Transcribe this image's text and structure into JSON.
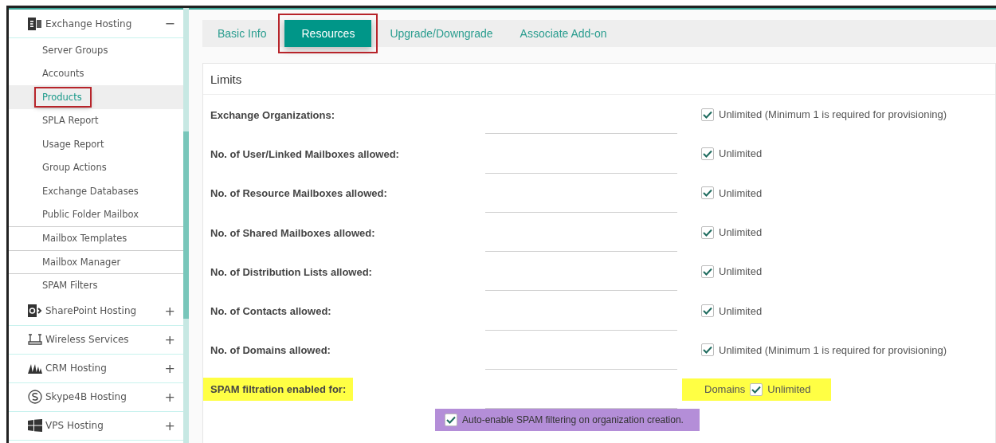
{
  "sidebar": {
    "items": [
      {
        "label": "Exchange Hosting",
        "expanded": true,
        "toggle": "−",
        "children": [
          {
            "label": "Server Groups",
            "selected": false,
            "outlined": false
          },
          {
            "label": "Accounts",
            "selected": false,
            "outlined": false
          },
          {
            "label": "Products",
            "selected": true,
            "outlined": true
          },
          {
            "label": "SPLA Report",
            "selected": false,
            "outlined": false
          },
          {
            "label": "Usage Report",
            "selected": false,
            "outlined": false
          },
          {
            "label": "Group Actions",
            "selected": false,
            "outlined": false
          },
          {
            "label": "Exchange Databases",
            "selected": false,
            "outlined": false
          },
          {
            "label": "Public Folder Mailbox",
            "selected": false,
            "outlined": false
          },
          {
            "label": "Mailbox Templates",
            "selected": false,
            "outlined": false
          },
          {
            "label": "Mailbox Manager",
            "selected": false,
            "outlined": false
          },
          {
            "label": "SPAM Filters",
            "selected": false,
            "outlined": false
          }
        ]
      },
      {
        "label": "SharePoint Hosting",
        "expanded": false,
        "toggle": "+"
      },
      {
        "label": "Wireless Services",
        "expanded": false,
        "toggle": "+"
      },
      {
        "label": "CRM Hosting",
        "expanded": false,
        "toggle": "+"
      },
      {
        "label": "Skype4B Hosting",
        "expanded": false,
        "toggle": "+"
      },
      {
        "label": "VPS Hosting",
        "expanded": false,
        "toggle": "+"
      }
    ]
  },
  "tabs": [
    {
      "label": "Basic Info",
      "selected": false,
      "outlined": false
    },
    {
      "label": "Resources",
      "selected": true,
      "outlined": true
    },
    {
      "label": "Upgrade/Downgrade",
      "selected": false,
      "outlined": false
    },
    {
      "label": "Associate Add-on",
      "selected": false,
      "outlined": false
    }
  ],
  "panel": {
    "title": "Limits",
    "rows": [
      {
        "label": "Exchange Organizations:",
        "unlimited_checked": true,
        "option": "Unlimited (Minimum 1 is required for provisioning)",
        "highlighted": false
      },
      {
        "label": "No. of User/Linked Mailboxes allowed:",
        "unlimited_checked": true,
        "option": "Unlimited",
        "highlighted": false
      },
      {
        "label": "No. of Resource Mailboxes allowed:",
        "unlimited_checked": true,
        "option": "Unlimited",
        "highlighted": false
      },
      {
        "label": "No. of Shared Mailboxes allowed:",
        "unlimited_checked": true,
        "option": "Unlimited",
        "highlighted": false
      },
      {
        "label": "No. of Distribution Lists allowed:",
        "unlimited_checked": true,
        "option": "Unlimited",
        "highlighted": false
      },
      {
        "label": "No. of Contacts allowed:",
        "unlimited_checked": true,
        "option": "Unlimited",
        "highlighted": false
      },
      {
        "label": "No. of Domains allowed:",
        "unlimited_checked": true,
        "option": "Unlimited (Minimum 1 is required for provisioning)",
        "highlighted": false
      },
      {
        "label": "SPAM filtration enabled for:",
        "unlimited_checked": true,
        "prefix": "Domains",
        "option": "Unlimited",
        "highlighted": true
      }
    ],
    "auto_enable": {
      "label": "Auto-enable SPAM filtering on organization creation.",
      "checked": true,
      "highlighted": true
    }
  }
}
